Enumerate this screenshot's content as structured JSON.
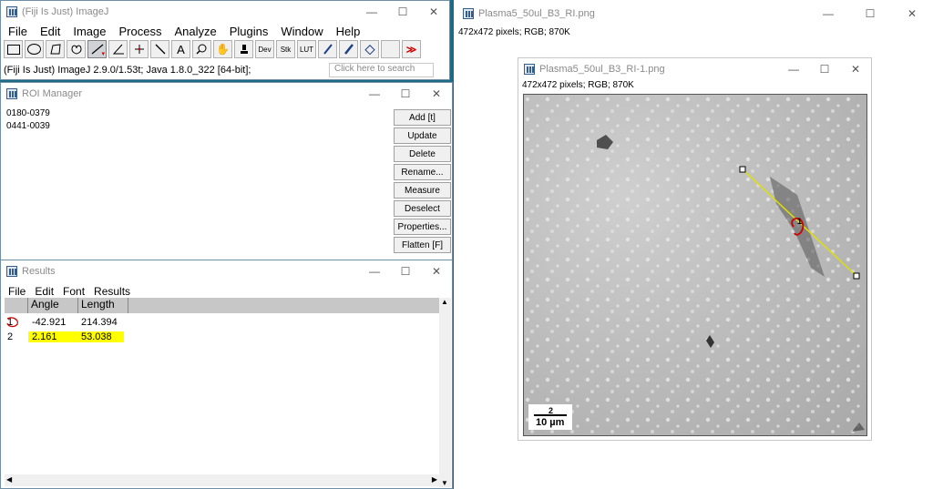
{
  "imagej": {
    "title": "(Fiji Is Just) ImageJ",
    "menu": [
      "File",
      "Edit",
      "Image",
      "Process",
      "Analyze",
      "Plugins",
      "Window",
      "Help"
    ],
    "tools": {
      "dev": "Dev",
      "stk": "Stk",
      "lut": "LUT"
    },
    "status": "(Fiji Is Just) ImageJ 2.9.0/1.53t; Java 1.8.0_322 [64-bit];",
    "search_placeholder": "Click here to search"
  },
  "roi_manager": {
    "title": "ROI Manager",
    "items": [
      "0180-0379",
      "0441-0039"
    ],
    "buttons": [
      "Add [t]",
      "Update",
      "Delete",
      "Rename...",
      "Measure",
      "Deselect",
      "Properties...",
      "Flatten [F]"
    ]
  },
  "results": {
    "title": "Results",
    "menu": [
      "File",
      "Edit",
      "Font",
      "Results"
    ],
    "columns": [
      "",
      "Angle",
      "Length"
    ],
    "rows": [
      {
        "idx": "1",
        "angle": "-42.921",
        "length": "214.394"
      },
      {
        "idx": "2",
        "angle": "2.161",
        "length": "53.038"
      }
    ]
  },
  "image_window": {
    "title": "Plasma5_50ul_B3_RI.png",
    "info": "472x472 pixels; RGB; 870K"
  },
  "image_child": {
    "title": "Plasma5_50ul_B3_RI-1.png",
    "info": "472x472 pixels; RGB; 870K",
    "scale_label": "10 µm",
    "annotation_number": "2",
    "line_marker": "1"
  },
  "colors": {
    "highlight": "#ffff00",
    "roi_line": "#e0e000",
    "annotation": "#cc0000"
  },
  "icons": [
    "rectangle-tool-icon",
    "oval-tool-icon",
    "polygon-tool-icon",
    "freehand-tool-icon",
    "line-tool-icon",
    "angle-tool-icon",
    "point-tool-icon",
    "wand-tool-icon",
    "text-tool-icon",
    "magnifier-icon",
    "hand-icon",
    "dropper-icon",
    "pencil-icon",
    "brush-icon",
    "flood-fill-icon",
    "more-tools-icon"
  ]
}
